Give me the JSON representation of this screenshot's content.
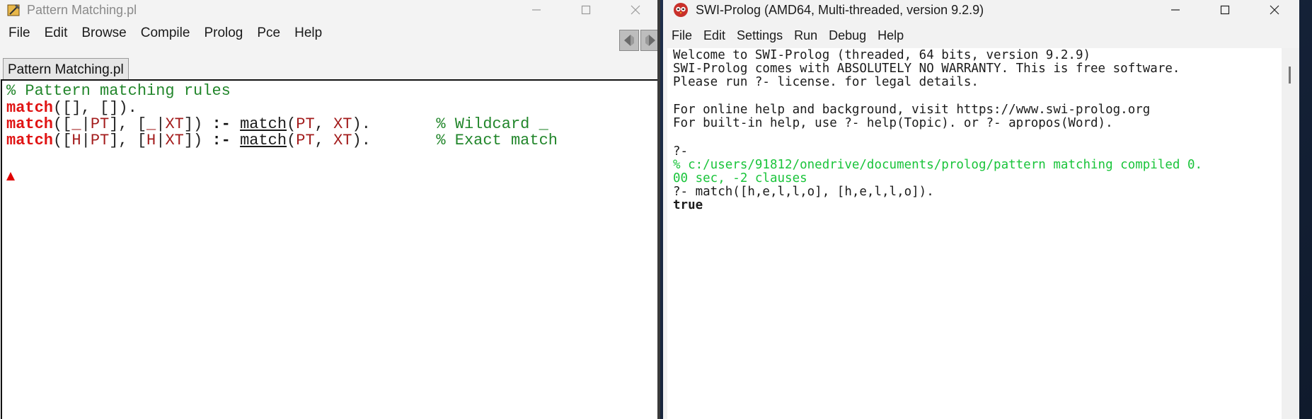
{
  "editor": {
    "title": "Pattern Matching.pl",
    "menus": [
      "File",
      "Edit",
      "Browse",
      "Compile",
      "Prolog",
      "Pce",
      "Help"
    ],
    "tab_label": "Pattern Matching.pl",
    "code": {
      "line1": "% Pattern matching rules",
      "line2": {
        "head": "match",
        "args": "([], [])."
      },
      "line3": {
        "head": "match",
        "a1": "([",
        "v1": "_",
        "s1": "|",
        "v2": "PT",
        "a2": "], [",
        "v3": "_",
        "s2": "|",
        "v4": "XT",
        "a3": "]) ",
        "op": ":-",
        "sp": " ",
        "call": "match",
        "a4": "(",
        "v5": "PT",
        "a5": ", ",
        "v6": "XT",
        "a6": ").",
        "pad": "       ",
        "comment": "% Wildcard _"
      },
      "line4": {
        "head": "match",
        "a1": "([",
        "v1": "H",
        "s1": "|",
        "v2": "PT",
        "a2": "], [",
        "v3": "H",
        "s2": "|",
        "v4": "XT",
        "a3": "]) ",
        "op": ":-",
        "sp": " ",
        "call": "match",
        "a4": "(",
        "v5": "PT",
        "a5": ", ",
        "v6": "XT",
        "a6": ").",
        "pad": "       ",
        "comment": "% Exact match"
      }
    }
  },
  "console": {
    "title": "SWI-Prolog (AMD64, Multi-threaded, version 9.2.9)",
    "menus": [
      "File",
      "Edit",
      "Settings",
      "Run",
      "Debug",
      "Help"
    ],
    "lines": {
      "welcome1": "Welcome to SWI-Prolog (threaded, 64 bits, version 9.2.9)",
      "welcome2": "SWI-Prolog comes with ABSOLUTELY NO WARRANTY. This is free software.",
      "welcome3": "Please run ?- license. for legal details.",
      "help1": "For online help and background, visit https://www.swi-prolog.org",
      "help2": "For built-in help, use ?- help(Topic). or ?- apropos(Word).",
      "prompt1": "?-",
      "compiled1": "% c:/users/91812/onedrive/documents/prolog/pattern matching compiled 0.",
      "compiled2": "00 sec, -2 clauses",
      "query": "?- match([h,e,l,l,o], [h,e,l,l,o]).",
      "result": "true"
    }
  },
  "colors": {
    "comment": "#22862b",
    "keyword": "#e01414",
    "variable": "#a31c1c",
    "console_green": "#19c43a"
  }
}
